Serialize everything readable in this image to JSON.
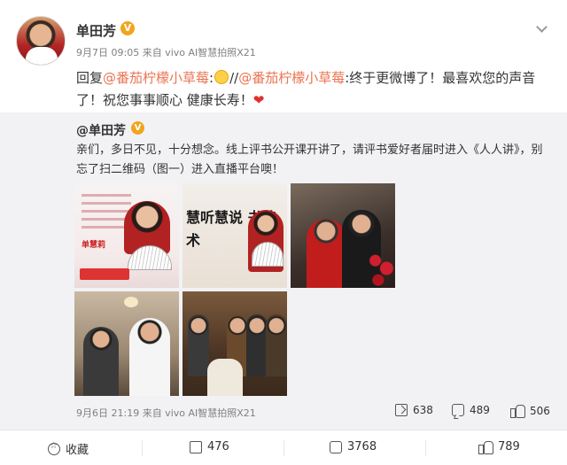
{
  "post": {
    "author": "单田芳",
    "verified_badge": "V",
    "meta": "9月7日 09:05 来自 vivo AI智慧拍照X21",
    "reply": {
      "prefix": "回复",
      "mention1": "@番茄柠檬小草莓",
      "colon1": ":",
      "separator": "//",
      "mention2": "@番茄柠檬小草莓",
      "text": ":终于更微博了！最喜欢您的声音了！祝您事事顺心 健康长寿！",
      "heart": "❤"
    }
  },
  "repost": {
    "author": "@单田芳",
    "verified_badge": "V",
    "text": "亲们，多日不见，十分想念。线上评书公开课开讲了，请评书爱好者届时进入《人人讲》，别忘了扫二维码（图一）进入直播平台噢！",
    "images": [
      {
        "alt": "poster-image",
        "name_text": "单慧莉"
      },
      {
        "alt": "poster-image-2",
        "banner_text": "慧听慧说 书艺术"
      },
      {
        "alt": "photo-couple"
      },
      {
        "alt": "photo-living-room"
      },
      {
        "alt": "photo-group"
      }
    ],
    "time": "9月6日 21:19 来自 vivo AI智慧拍照X21",
    "stats": {
      "shares": "638",
      "comments": "489",
      "likes": "506"
    }
  },
  "actions": {
    "favorite": "收藏",
    "share": "476",
    "comment": "3768",
    "like": "789"
  },
  "colors": {
    "mention": "#eb7350",
    "verified": "#f0a51d",
    "repost_bg": "#f2f2f5"
  },
  "icons": [
    "chevron-down-icon",
    "verified-icon",
    "emoji-smile-icon",
    "heart-icon",
    "share-icon",
    "comment-icon",
    "like-icon",
    "favorite-icon"
  ]
}
